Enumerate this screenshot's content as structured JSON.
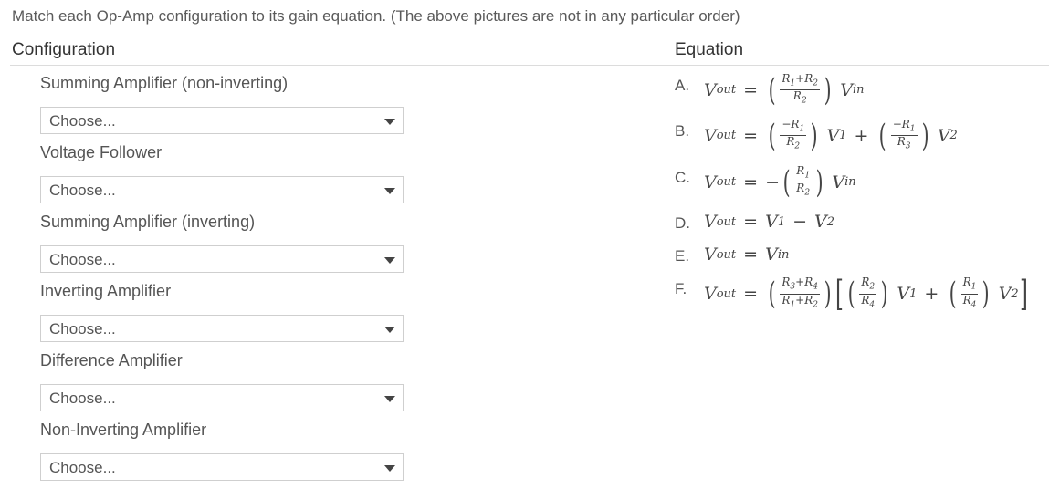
{
  "instruction": "Match each Op-Amp configuration to its gain equation. (The above pictures are not in any particular order)",
  "headers": {
    "configuration": "Configuration",
    "equation": "Equation"
  },
  "rows": [
    {
      "label": "Summing Amplifier (non-inverting)",
      "select": "Choose..."
    },
    {
      "label": "Voltage Follower",
      "select": "Choose..."
    },
    {
      "label": "Summing Amplifier (inverting)",
      "select": "Choose..."
    },
    {
      "label": "Inverting Amplifier",
      "select": "Choose..."
    },
    {
      "label": "Difference Amplifier",
      "select": "Choose..."
    },
    {
      "label": "Non-Inverting Amplifier",
      "select": "Choose..."
    }
  ],
  "equation_letters": [
    "A.",
    "B.",
    "C.",
    "D.",
    "E.",
    "F."
  ],
  "equations_text": [
    "Vout = ((R1+R2)/R2) Vin",
    "Vout = (−R1/R2) V1 + (−R1/R3) V2",
    "Vout = −(R1/R2) Vin",
    "Vout = V1 − V2",
    "Vout = Vin",
    "Vout = ((R3+R4)/(R1+R2)) [(R2/R4) V1 + (R1/R4) V2]"
  ],
  "colors": {
    "text": "#555555",
    "heading": "#333333",
    "border": "#cfcfcf",
    "rule": "#dcdcdc"
  }
}
